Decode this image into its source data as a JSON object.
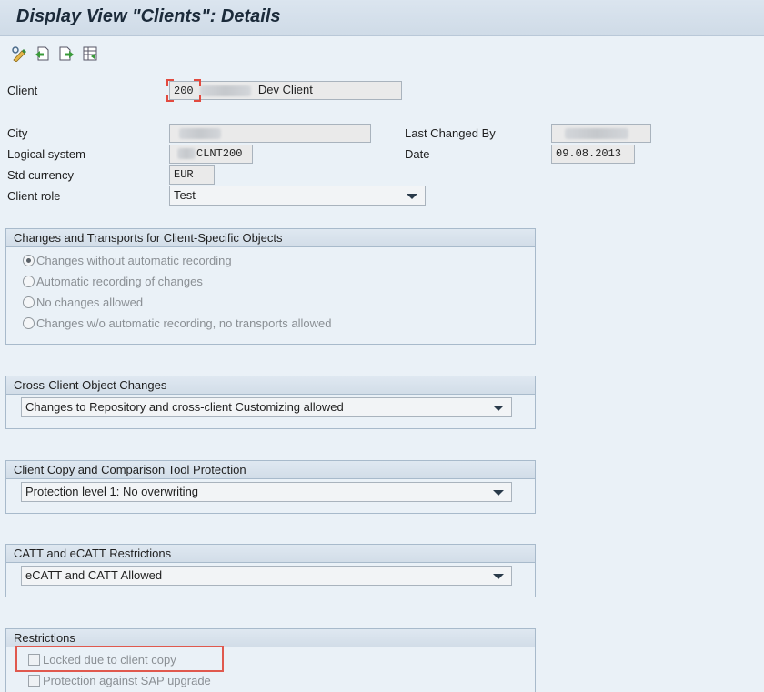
{
  "title": "Display View \"Clients\": Details",
  "toolbar": [
    {
      "name": "display-change-icon"
    },
    {
      "name": "previous-entry-icon"
    },
    {
      "name": "next-entry-icon"
    },
    {
      "name": "other-entry-icon"
    }
  ],
  "header": {
    "client_label": "Client",
    "client_number": "200",
    "client_name": "Dev Client",
    "city_label": "City",
    "logical_system_label": "Logical system",
    "logical_system_value": "CLNT200",
    "std_currency_label": "Std currency",
    "std_currency_value": "EUR",
    "client_role_label": "Client role",
    "client_role_value": "Test",
    "last_changed_label": "Last Changed By",
    "date_label": "Date",
    "date_value": "09.08.2013"
  },
  "changes_transports": {
    "title": "Changes and Transports for Client-Specific Objects",
    "options": [
      {
        "label": "Changes without automatic recording",
        "selected": true
      },
      {
        "label": "Automatic recording of changes",
        "selected": false
      },
      {
        "label": "No changes allowed",
        "selected": false
      },
      {
        "label": "Changes w/o automatic recording, no transports allowed",
        "selected": false
      }
    ]
  },
  "cross_client": {
    "title": "Cross-Client Object Changes",
    "value": "Changes to Repository and cross-client Customizing allowed"
  },
  "copy_protection": {
    "title": "Client Copy and Comparison Tool Protection",
    "value": "Protection level 1: No overwriting"
  },
  "catt": {
    "title": "CATT and eCATT Restrictions",
    "value": "eCATT and CATT Allowed"
  },
  "restrictions": {
    "title": "Restrictions",
    "items": [
      {
        "label": "Locked due to client copy",
        "checked": false
      },
      {
        "label": "Protection against SAP upgrade",
        "checked": false
      }
    ]
  },
  "colors": {
    "background": "#eaf1f7",
    "highlight": "#e0594e"
  }
}
